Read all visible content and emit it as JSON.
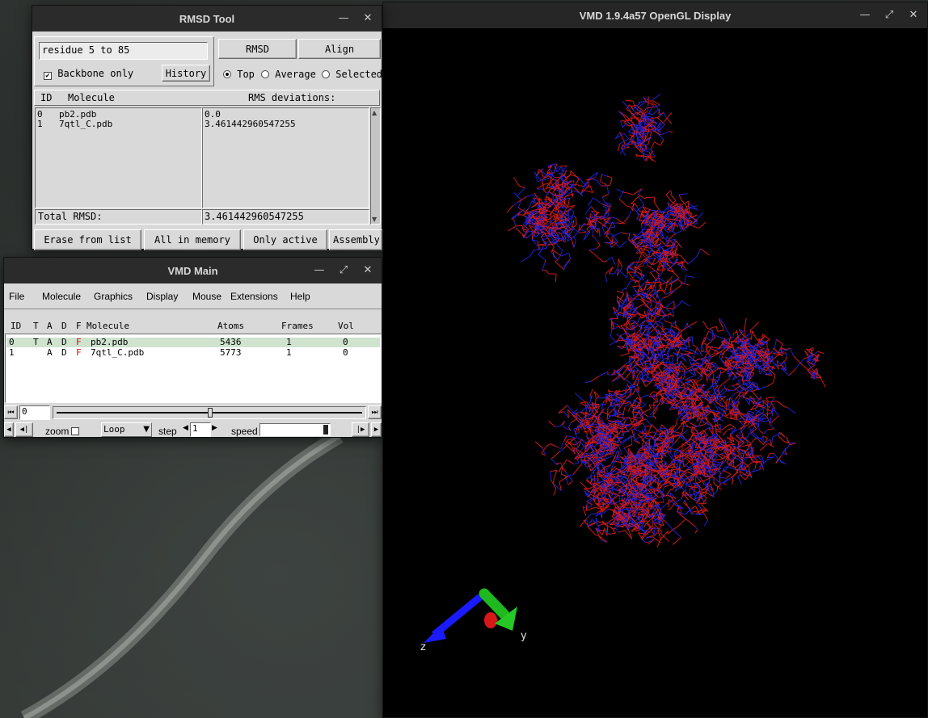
{
  "gl_window": {
    "title": "VMD 1.9.4a57 OpenGL Display",
    "axes": {
      "x_label": "",
      "y_label": "y",
      "z_label": "z"
    },
    "colors": {
      "molecule_0": "#2020d0",
      "molecule_1": "#d01818"
    }
  },
  "rmsd_window": {
    "title": "RMSD Tool",
    "selection_value": "residue 5 to 85",
    "backbone_label": "Backbone only",
    "backbone_checked": "✔",
    "history_label": "History",
    "rmsd_button": "RMSD",
    "align_button": "Align",
    "ref_options": [
      "Top",
      "Average",
      "Selected"
    ],
    "table": {
      "col_id": "ID",
      "col_molecule": "Molecule",
      "col_rms": "RMS deviations:",
      "rows": [
        {
          "id": "0",
          "molecule": "pb2.pdb",
          "rms": "0.0"
        },
        {
          "id": "1",
          "molecule": "7qtl_C.pdb",
          "rms": "3.461442960547255"
        }
      ],
      "total_label": "Total RMSD:",
      "total_value": "3.461442960547255"
    },
    "buttons": {
      "erase": "Erase from list",
      "all_in_memory": "All in memory",
      "only_active": "Only active",
      "assembly": "Assembly"
    }
  },
  "main_window": {
    "title": "VMD Main",
    "menu": [
      "File",
      "Molecule",
      "Graphics",
      "Display",
      "Mouse",
      "Extensions",
      "Help"
    ],
    "columns": {
      "id": "ID",
      "t": "T",
      "a": "A",
      "d": "D",
      "f": "F",
      "molecule": "Molecule",
      "atoms": "Atoms",
      "frames": "Frames",
      "vol": "Vol"
    },
    "molecules": [
      {
        "id": "0",
        "t": "T",
        "a": "A",
        "d": "D",
        "f": "F",
        "name": "pb2.pdb",
        "atoms": "5436",
        "frames": "1",
        "vol": "0"
      },
      {
        "id": "1",
        "t": "",
        "a": "A",
        "d": "D",
        "f": "F",
        "name": "7qtl_C.pdb",
        "atoms": "5773",
        "frames": "1",
        "vol": "0"
      }
    ],
    "frame_value": "0",
    "zoom_label": "zoom",
    "loop_value": "Loop",
    "step_label": "step",
    "step_value": "1",
    "speed_label": "speed"
  }
}
